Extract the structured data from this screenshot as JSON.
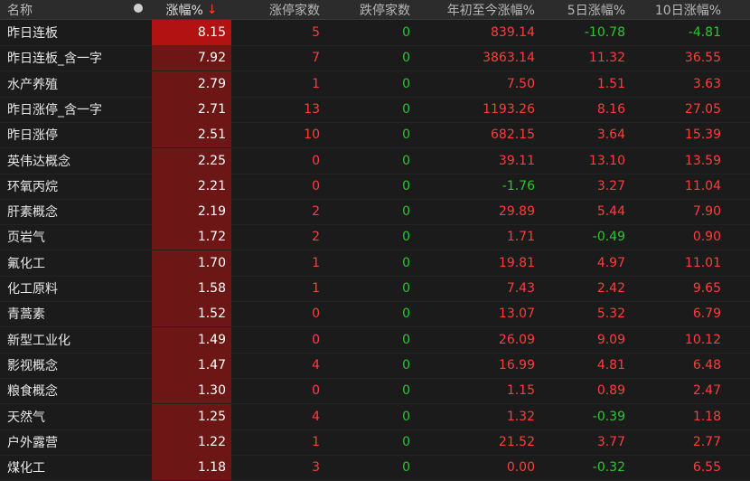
{
  "header": {
    "name": "名称",
    "change_pct": "涨幅%",
    "sort_arrow": "↓",
    "limit_up_count": "涨停家数",
    "limit_down_count": "跌停家数",
    "ytd_change": "年初至今涨幅%",
    "d5_change": "5日涨幅%",
    "d10_change": "10日涨幅%"
  },
  "colors": {
    "up": "#ff3c3c",
    "down": "#2ec52e",
    "change_bg_max": "#b31212",
    "change_bg": "#6d1616"
  },
  "rows": [
    {
      "name": "昨日连板",
      "chg": "8.15",
      "up": "5",
      "dn": "0",
      "ytd": "839.14",
      "d5": "-10.78",
      "d10": "-4.81"
    },
    {
      "name": "昨日连板_含一字",
      "chg": "7.92",
      "up": "7",
      "dn": "0",
      "ytd": "3863.14",
      "d5": "11.32",
      "d10": "36.55"
    },
    {
      "name": "水产养殖",
      "chg": "2.79",
      "up": "1",
      "dn": "0",
      "ytd": "7.50",
      "d5": "1.51",
      "d10": "3.63"
    },
    {
      "name": "昨日涨停_含一字",
      "chg": "2.71",
      "up": "13",
      "dn": "0",
      "ytd": "1193.26",
      "d5": "8.16",
      "d10": "27.05"
    },
    {
      "name": "昨日涨停",
      "chg": "2.51",
      "up": "10",
      "dn": "0",
      "ytd": "682.15",
      "d5": "3.64",
      "d10": "15.39"
    },
    {
      "name": "英伟达概念",
      "chg": "2.25",
      "up": "0",
      "dn": "0",
      "ytd": "39.11",
      "d5": "13.10",
      "d10": "13.59"
    },
    {
      "name": "环氧丙烷",
      "chg": "2.21",
      "up": "0",
      "dn": "0",
      "ytd": "-1.76",
      "d5": "3.27",
      "d10": "11.04"
    },
    {
      "name": "肝素概念",
      "chg": "2.19",
      "up": "2",
      "dn": "0",
      "ytd": "29.89",
      "d5": "5.44",
      "d10": "7.90"
    },
    {
      "name": "页岩气",
      "chg": "1.72",
      "up": "2",
      "dn": "0",
      "ytd": "1.71",
      "d5": "-0.49",
      "d10": "0.90"
    },
    {
      "name": "氟化工",
      "chg": "1.70",
      "up": "1",
      "dn": "0",
      "ytd": "19.81",
      "d5": "4.97",
      "d10": "11.01"
    },
    {
      "name": "化工原料",
      "chg": "1.58",
      "up": "1",
      "dn": "0",
      "ytd": "7.43",
      "d5": "2.42",
      "d10": "9.65"
    },
    {
      "name": "青蒿素",
      "chg": "1.52",
      "up": "0",
      "dn": "0",
      "ytd": "13.07",
      "d5": "5.32",
      "d10": "6.79"
    },
    {
      "name": "新型工业化",
      "chg": "1.49",
      "up": "0",
      "dn": "0",
      "ytd": "26.09",
      "d5": "9.09",
      "d10": "10.12"
    },
    {
      "name": "影视概念",
      "chg": "1.47",
      "up": "4",
      "dn": "0",
      "ytd": "16.99",
      "d5": "4.81",
      "d10": "6.48"
    },
    {
      "name": "粮食概念",
      "chg": "1.30",
      "up": "0",
      "dn": "0",
      "ytd": "1.15",
      "d5": "0.89",
      "d10": "2.47"
    },
    {
      "name": "天然气",
      "chg": "1.25",
      "up": "4",
      "dn": "0",
      "ytd": "1.32",
      "d5": "-0.39",
      "d10": "1.18"
    },
    {
      "name": "户外露营",
      "chg": "1.22",
      "up": "1",
      "dn": "0",
      "ytd": "21.52",
      "d5": "3.77",
      "d10": "2.77"
    },
    {
      "name": "煤化工",
      "chg": "1.18",
      "up": "3",
      "dn": "0",
      "ytd": "0.00",
      "d5": "-0.32",
      "d10": "6.55"
    }
  ]
}
